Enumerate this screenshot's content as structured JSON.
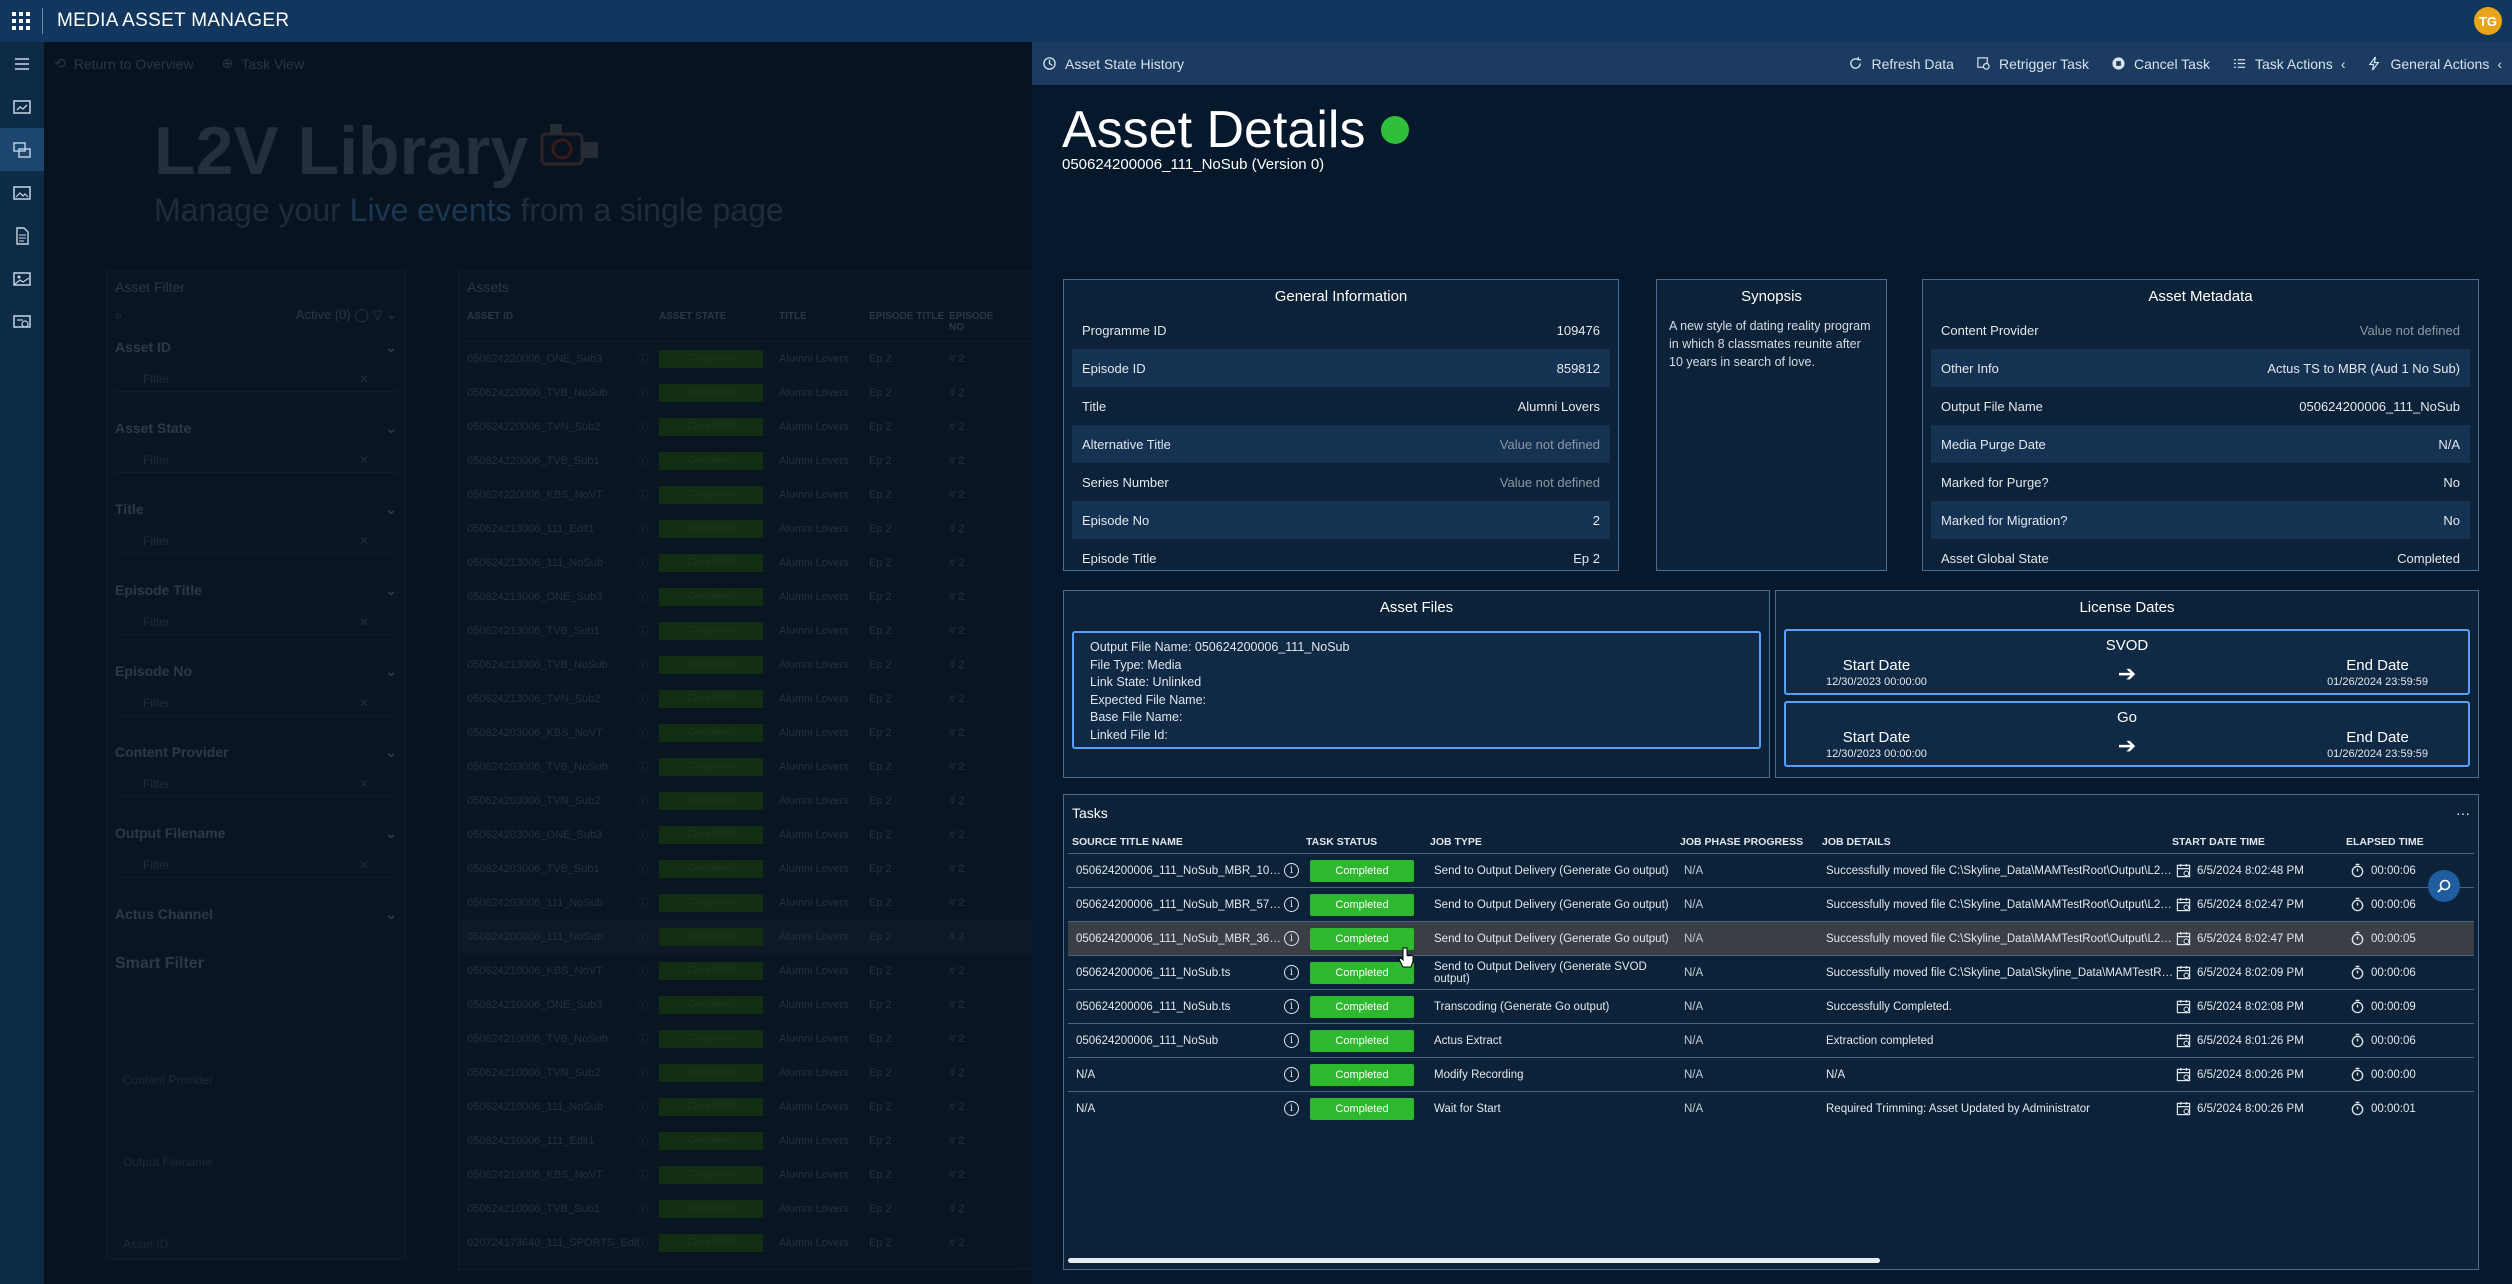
{
  "app": {
    "title": "MEDIA ASSET MANAGER",
    "avatar_initials": "TG"
  },
  "library": {
    "breadcrumbs": [
      "Return to Overview",
      "Task View"
    ],
    "title": "L2V Library",
    "subtitle_pre": "Manage your ",
    "subtitle_highlight": "Live events",
    "subtitle_post": " from a single page",
    "filter": {
      "panel_title": "Asset Filter",
      "active_label": "Active (0)",
      "fields": [
        "Asset ID",
        "Asset State",
        "Title",
        "Episode Title",
        "Episode No",
        "Content Provider",
        "Output Filename",
        "Actus Channel"
      ],
      "placeholder": "Filter",
      "smart_filter": "Smart Filter",
      "smart_items": [
        "Content Provider",
        "Output Filename",
        "Asset ID"
      ]
    },
    "assets": {
      "panel_title": "Assets",
      "columns": [
        "ASSET ID",
        "ASSET STATE",
        "TITLE",
        "EPISODE TITLE",
        "EPISODE NO"
      ],
      "rows": [
        {
          "id": "050624220006_ONE_Sub3",
          "state": "Completed",
          "title": "Alumni Lovers",
          "ep": "Ep 2",
          "no": "2"
        },
        {
          "id": "050624220006_TVB_NoSub",
          "state": "Completed",
          "title": "Alumni Lovers",
          "ep": "Ep 2",
          "no": "2"
        },
        {
          "id": "050624220006_TVN_Sub2",
          "state": "Completed",
          "title": "Alumni Lovers",
          "ep": "Ep 2",
          "no": "2"
        },
        {
          "id": "050624220006_TVB_Sub1",
          "state": "Completed",
          "title": "Alumni Lovers",
          "ep": "Ep 2",
          "no": "2"
        },
        {
          "id": "050624220006_KBS_NoVT",
          "state": "Completed",
          "title": "Alumni Lovers",
          "ep": "Ep 2",
          "no": "2"
        },
        {
          "id": "050624213006_111_Edit1",
          "state": "Completed",
          "title": "Alumni Lovers",
          "ep": "Ep 2",
          "no": "2"
        },
        {
          "id": "050624213006_111_NoSub",
          "state": "Completed",
          "title": "Alumni Lovers",
          "ep": "Ep 2",
          "no": "2"
        },
        {
          "id": "050624213006_ONE_Sub3",
          "state": "Completed",
          "title": "Alumni Lovers",
          "ep": "Ep 2",
          "no": "2"
        },
        {
          "id": "050624213006_TVB_Sub1",
          "state": "Completed",
          "title": "Alumni Lovers",
          "ep": "Ep 2",
          "no": "2"
        },
        {
          "id": "050624213006_TVB_NoSub",
          "state": "Completed",
          "title": "Alumni Lovers",
          "ep": "Ep 2",
          "no": "2"
        },
        {
          "id": "050624213006_TVN_Sub2",
          "state": "Completed",
          "title": "Alumni Lovers",
          "ep": "Ep 2",
          "no": "2"
        },
        {
          "id": "050624203006_KBS_NoVT",
          "state": "Completed",
          "title": "Alumni Lovers",
          "ep": "Ep 2",
          "no": "2"
        },
        {
          "id": "050624203006_TVB_NoSub",
          "state": "Completed",
          "title": "Alumni Lovers",
          "ep": "Ep 2",
          "no": "2"
        },
        {
          "id": "050624203006_TVN_Sub2",
          "state": "Completed",
          "title": "Alumni Lovers",
          "ep": "Ep 2",
          "no": "2"
        },
        {
          "id": "050624203006_ONE_Sub3",
          "state": "Completed",
          "title": "Alumni Lovers",
          "ep": "Ep 2",
          "no": "2"
        },
        {
          "id": "050624203006_TVB_Sub1",
          "state": "Completed",
          "title": "Alumni Lovers",
          "ep": "Ep 2",
          "no": "2"
        },
        {
          "id": "050624203006_111_NoSub",
          "state": "Completed",
          "title": "Alumni Lovers",
          "ep": "Ep 2",
          "no": "2"
        },
        {
          "id": "050624200006_111_NoSub",
          "state": "Completed",
          "title": "Alumni Lovers",
          "ep": "Ep 2",
          "no": "2"
        },
        {
          "id": "050624210006_KBS_NoVT",
          "state": "Completed",
          "title": "Alumni Lovers",
          "ep": "Ep 2",
          "no": "2"
        },
        {
          "id": "050624210006_ONE_Sub3",
          "state": "Completed",
          "title": "Alumni Lovers",
          "ep": "Ep 2",
          "no": "2"
        },
        {
          "id": "050624210006_TVB_NoSub",
          "state": "Completed",
          "title": "Alumni Lovers",
          "ep": "Ep 2",
          "no": "2"
        },
        {
          "id": "050624210006_TVN_Sub2",
          "state": "Completed",
          "title": "Alumni Lovers",
          "ep": "Ep 2",
          "no": "2"
        },
        {
          "id": "050624210006_111_NoSub",
          "state": "Completed",
          "title": "Alumni Lovers",
          "ep": "Ep 2",
          "no": "2"
        },
        {
          "id": "050624210006_111_Edit1",
          "state": "Completed",
          "title": "Alumni Lovers",
          "ep": "Ep 2",
          "no": "2"
        },
        {
          "id": "050624210006_KBS_NoVT",
          "state": "Completed",
          "title": "Alumni Lovers",
          "ep": "Ep 2",
          "no": "2"
        },
        {
          "id": "050624210006_TVB_Sub1",
          "state": "Completed",
          "title": "Alumni Lovers",
          "ep": "Ep 2",
          "no": "2"
        },
        {
          "id": "020724173640_111_SPORTS_Edit",
          "state": "Completed",
          "title": "Alumni Lovers",
          "ep": "Ep 2",
          "no": "2"
        }
      ]
    }
  },
  "details": {
    "toolbar": {
      "history": "Asset State History",
      "refresh": "Refresh Data",
      "retrigger": "Retrigger Task",
      "cancel": "Cancel Task",
      "task_actions": "Task Actions",
      "general_actions": "General Actions"
    },
    "title": "Asset Details",
    "subtitle": "050624200006_111_NoSub (Version 0)",
    "status_color": "#2fbf3a",
    "general_info": {
      "header": "General Information",
      "rows": [
        {
          "k": "Programme ID",
          "v": "109476"
        },
        {
          "k": "Episode ID",
          "v": "859812"
        },
        {
          "k": "Title",
          "v": "Alumni Lovers"
        },
        {
          "k": "Alternative Title",
          "v": "Value not defined"
        },
        {
          "k": "Series Number",
          "v": "Value not defined"
        },
        {
          "k": "Episode No",
          "v": "2"
        },
        {
          "k": "Episode Title",
          "v": "Ep 2"
        }
      ]
    },
    "synopsis": {
      "header": "Synopsis",
      "text": "A new style of dating reality program in which 8 classmates reunite after 10 years in search of love."
    },
    "metadata": {
      "header": "Asset Metadata",
      "rows": [
        {
          "k": "Content Provider",
          "v": "Value not defined"
        },
        {
          "k": "Other Info",
          "v": "Actus TS to MBR (Aud 1 No Sub)"
        },
        {
          "k": "Output File Name",
          "v": "050624200006_111_NoSub"
        },
        {
          "k": "Media Purge Date",
          "v": "N/A"
        },
        {
          "k": "Marked for Purge?",
          "v": "No"
        },
        {
          "k": "Marked for Migration?",
          "v": "No"
        },
        {
          "k": "Asset Global State",
          "v": "Completed"
        }
      ]
    },
    "asset_files": {
      "header": "Asset Files",
      "lines": [
        "Output File Name: 050624200006_111_NoSub",
        "File Type: Media",
        "Link State: Unlinked",
        "Expected File Name:",
        "Base File Name:",
        "Linked File Id:"
      ]
    },
    "license": {
      "header": "License Dates",
      "start_label": "Start Date",
      "end_label": "End Date",
      "items": [
        {
          "name": "SVOD",
          "start": "12/30/2023 00:00:00",
          "end": "01/26/2024 23:59:59"
        },
        {
          "name": "Go",
          "start": "12/30/2023 00:00:00",
          "end": "01/26/2024 23:59:59"
        }
      ]
    },
    "tasks": {
      "header": "Tasks",
      "more": "···",
      "columns": [
        "SOURCE TITLE NAME",
        "TASK STATUS",
        "JOB TYPE",
        "JOB PHASE PROGRESS",
        "JOB DETAILS",
        "START DATE TIME",
        "ELAPSED TIME"
      ],
      "rows": [
        {
          "src": "050624200006_111_NoSub_MBR_1080p...",
          "status": "Completed",
          "type": "Send to Output Delivery (Generate Go output)",
          "progress": "N/A",
          "details": "Successfully moved file C:\\Skyline_Data\\MAMTestRoot\\Output\\L2V_T...",
          "start": "6/5/2024 8:02:48 PM",
          "elapsed": "00:00:06"
        },
        {
          "src": "050624200006_111_NoSub_MBR_576p...",
          "status": "Completed",
          "type": "Send to Output Delivery (Generate Go output)",
          "progress": "N/A",
          "details": "Successfully moved file C:\\Skyline_Data\\MAMTestRoot\\Output\\L2V_T...",
          "start": "6/5/2024 8:02:47 PM",
          "elapsed": "00:00:06"
        },
        {
          "src": "050624200006_111_NoSub_MBR_360p...",
          "status": "Completed",
          "type": "Send to Output Delivery (Generate Go output)",
          "progress": "N/A",
          "details": "Successfully moved file C:\\Skyline_Data\\MAMTestRoot\\Output\\L2V_T...",
          "start": "6/5/2024 8:02:47 PM",
          "elapsed": "00:00:05"
        },
        {
          "src": "050624200006_111_NoSub.ts",
          "status": "Completed",
          "type": "Send to Output Delivery (Generate SVOD output)",
          "progress": "N/A",
          "details": "Successfully moved file C:\\Skyline_Data\\Skyline_Data\\MAMTestRoot\\...",
          "start": "6/5/2024 8:02:09 PM",
          "elapsed": "00:00:06"
        },
        {
          "src": "050624200006_111_NoSub.ts",
          "status": "Completed",
          "type": "Transcoding (Generate Go output)",
          "progress": "N/A",
          "details": "Successfully Completed.",
          "start": "6/5/2024 8:02:08 PM",
          "elapsed": "00:00:09"
        },
        {
          "src": "050624200006_111_NoSub",
          "status": "Completed",
          "type": "Actus Extract",
          "progress": "N/A",
          "details": "Extraction completed",
          "start": "6/5/2024 8:01:26 PM",
          "elapsed": "00:00:06"
        },
        {
          "src": "N/A",
          "status": "Completed",
          "type": "Modify Recording",
          "progress": "N/A",
          "details": "N/A",
          "start": "6/5/2024 8:00:26 PM",
          "elapsed": "00:00:00"
        },
        {
          "src": "N/A",
          "status": "Completed",
          "type": "Wait for Start",
          "progress": "N/A",
          "details": "Required Trimming: Asset Updated by Administrator",
          "start": "6/5/2024 8:00:26 PM",
          "elapsed": "00:00:01"
        }
      ]
    }
  }
}
